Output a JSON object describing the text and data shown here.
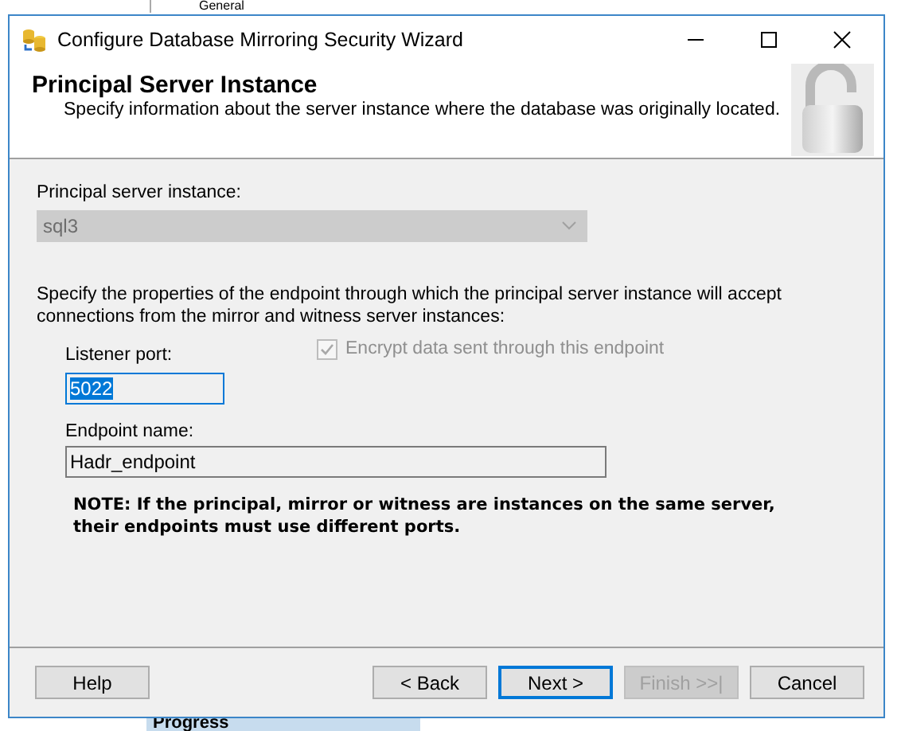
{
  "background": {
    "top_label": "General",
    "bottom_label": "Progress"
  },
  "window": {
    "title": "Configure Database Mirroring Security Wizard"
  },
  "header": {
    "title": "Principal Server Instance",
    "subtitle": "Specify information about the server instance where the database was originally located."
  },
  "principal": {
    "label": "Principal server instance:",
    "value": "sql3",
    "disabled": true
  },
  "endpoint": {
    "description": "Specify the properties of the endpoint through which the principal server instance will accept connections from the mirror and witness server instances:",
    "listener_port": {
      "label": "Listener port:",
      "value": "5022"
    },
    "encrypt": {
      "label": "Encrypt data sent through this endpoint",
      "checked": true,
      "disabled": true
    },
    "endpoint_name": {
      "label": "Endpoint name:",
      "value": "Hadr_endpoint"
    }
  },
  "note": {
    "lines": [
      "NOTE: If the principal, mirror or witness are instances on the same server,",
      "their endpoints must use different ports."
    ]
  },
  "buttons": [
    {
      "label": "Help",
      "kind": "help",
      "disabled": false,
      "default": false
    },
    {
      "label": "< Back",
      "kind": "back",
      "disabled": false,
      "default": false
    },
    {
      "label": "Next >",
      "kind": "next",
      "disabled": false,
      "default": true
    },
    {
      "label": "Finish >>|",
      "kind": "finish",
      "disabled": true,
      "default": false
    },
    {
      "label": "Cancel",
      "kind": "cancel",
      "disabled": false,
      "default": false
    }
  ]
}
